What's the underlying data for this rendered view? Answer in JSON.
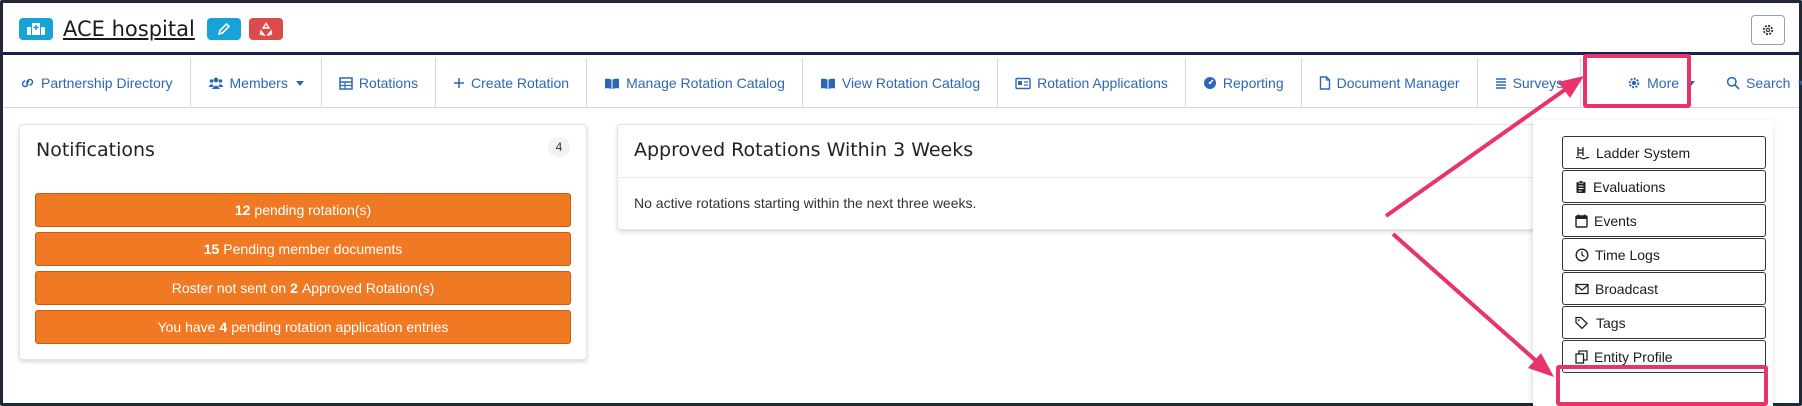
{
  "header": {
    "title": "ACE hospital",
    "icons": {
      "hospital": "hospital-icon",
      "edit": "pencil-icon",
      "recycle": "recycle-icon",
      "settings": "gear-icon"
    }
  },
  "nav": {
    "items": [
      {
        "label": "Partnership Directory",
        "icon": "link-icon"
      },
      {
        "label": "Members",
        "icon": "users-icon",
        "caret": true
      },
      {
        "label": "Rotations",
        "icon": "table-icon"
      },
      {
        "label": "Create Rotation",
        "icon": "plus-icon"
      },
      {
        "label": "Manage Rotation Catalog",
        "icon": "book-open-icon"
      },
      {
        "label": "View Rotation Catalog",
        "icon": "book-open-icon"
      },
      {
        "label": "Rotation Applications",
        "icon": "id-card-icon"
      },
      {
        "label": "Reporting",
        "icon": "gauge-icon"
      },
      {
        "label": "Document Manager",
        "icon": "file-icon"
      },
      {
        "label": "Surveys",
        "icon": "list-icon"
      },
      {
        "label": "More",
        "icon": "gear-icon",
        "caret": true
      },
      {
        "label": "Search",
        "icon": "search-icon",
        "caret": true
      }
    ]
  },
  "notifications": {
    "title": "Notifications",
    "count": "4",
    "items": [
      {
        "prefix": "",
        "bold": "12",
        "suffix": "pending rotation(s)"
      },
      {
        "prefix": "",
        "bold": "15",
        "suffix": "Pending member documents"
      },
      {
        "prefix": "Roster not sent on",
        "bold": "2",
        "suffix": "Approved Rotation(s)"
      },
      {
        "prefix": "You have",
        "bold": "4",
        "suffix": "pending rotation application entries"
      }
    ]
  },
  "approved": {
    "title": "Approved Rotations Within 3 Weeks",
    "message": "No active rotations starting within the next three weeks."
  },
  "more_menu": {
    "items": [
      {
        "label": "Ladder System",
        "icon": "ladder-icon"
      },
      {
        "label": "Evaluations",
        "icon": "clipboard-icon"
      },
      {
        "label": "Events",
        "icon": "calendar-icon"
      },
      {
        "label": "Time Logs",
        "icon": "clock-icon"
      },
      {
        "label": "Broadcast",
        "icon": "envelope-icon"
      },
      {
        "label": "Tags",
        "icon": "tags-icon"
      },
      {
        "label": "Entity Profile",
        "icon": "copy-icon"
      }
    ]
  },
  "colors": {
    "link": "#2d66b9",
    "notification": "#f07a24",
    "highlight": "#e8336b",
    "brand_blue": "#17a2d8",
    "danger": "#dc4a4a"
  }
}
